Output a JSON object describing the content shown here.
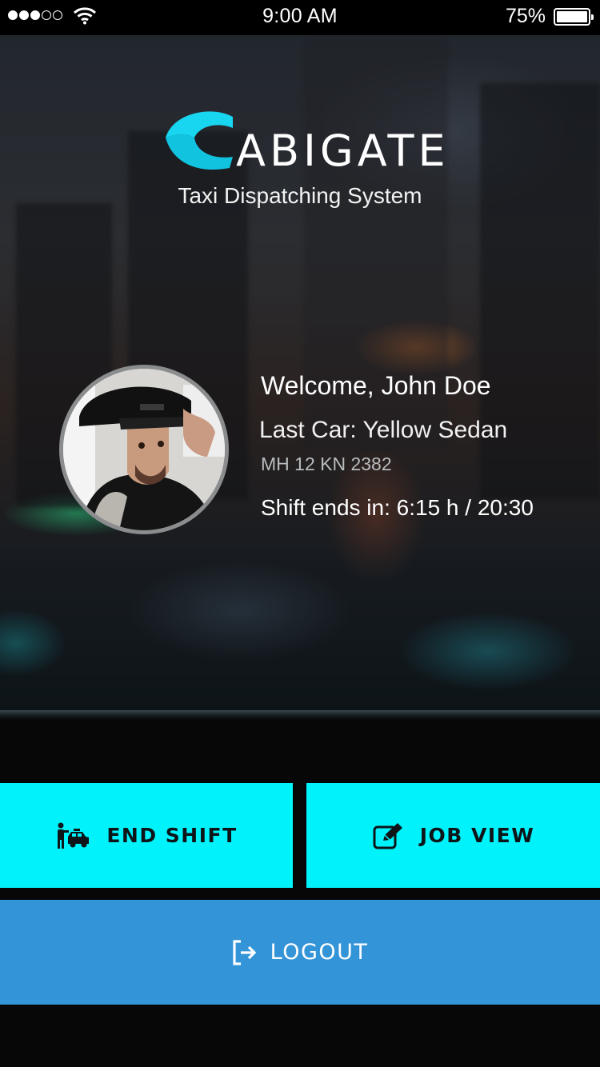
{
  "status_bar": {
    "time": "9:00 AM",
    "battery_percent": "75%",
    "signal_bars_filled": 3,
    "signal_bars_total": 5,
    "battery_level": 0.75
  },
  "brand": {
    "logo_text": "ABIGATE",
    "tagline": "Taxi Dispatching System",
    "accent_color": "#19d6f0"
  },
  "driver": {
    "welcome": "Welcome, John Doe",
    "last_car": "Last Car: Yellow Sedan",
    "plate": "MH 12 KN 2382",
    "shift": "Shift ends in: 6:15 h / 20:30"
  },
  "actions": {
    "end_shift": {
      "label": "END SHIFT",
      "icon": "driver-taxi-icon",
      "color": "#00f3fb"
    },
    "job_view": {
      "label": "JOB VIEW",
      "icon": "edit-icon",
      "color": "#00f3fb"
    },
    "logout": {
      "label": "LOGOUT",
      "icon": "logout-icon",
      "color": "#3494d8"
    }
  }
}
